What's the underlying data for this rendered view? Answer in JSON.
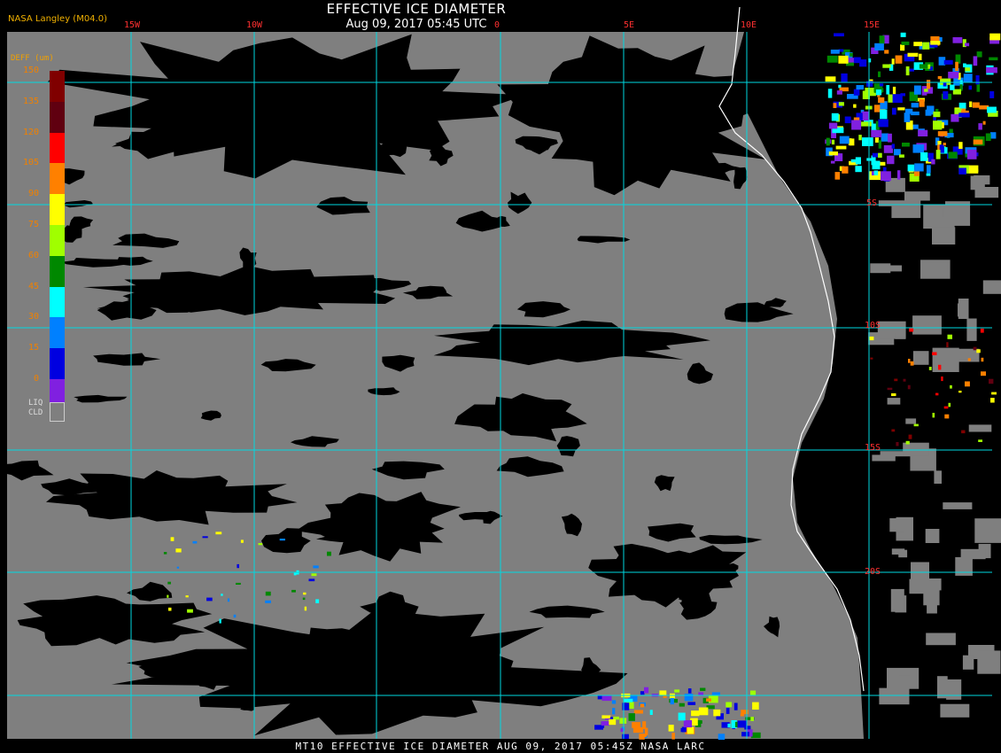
{
  "header": {
    "title": "EFFECTIVE ICE DIAMETER",
    "timestamp": "Aug 09, 2017 05:45 UTC",
    "producer": "NASA Langley (M04.0)"
  },
  "footer": {
    "caption": "MT10  EFFECTIVE ICE DIAMETER   AUG 09, 2017 05:45Z   NASA LARC"
  },
  "grid": {
    "longitudes": [
      "15W",
      "10W",
      "0",
      "5E",
      "10E",
      "15E"
    ],
    "latitudes": [
      "5S",
      "10S",
      "15S",
      "20S"
    ],
    "color": "#00d8e0"
  },
  "legend": {
    "title": "DEFF (um)",
    "ticks": [
      "150",
      "135",
      "120",
      "105",
      "90",
      "75",
      "60",
      "45",
      "30",
      "15",
      "0"
    ],
    "colors": [
      "#800000",
      "#600010",
      "#ff0000",
      "#ff8000",
      "#ffff00",
      "#a0ff00",
      "#008800",
      "#00ffff",
      "#0080ff",
      "#0000e0",
      "#8020e0"
    ],
    "liquid_label_1": "LIQ",
    "liquid_label_2": "CLD",
    "liquid_color": "#7f7f7f"
  },
  "map": {
    "cloud_gray": "#7f7f7f",
    "clear_black": "#000000",
    "coastline_color": "#ffffff",
    "label_color": "#ff3030"
  }
}
